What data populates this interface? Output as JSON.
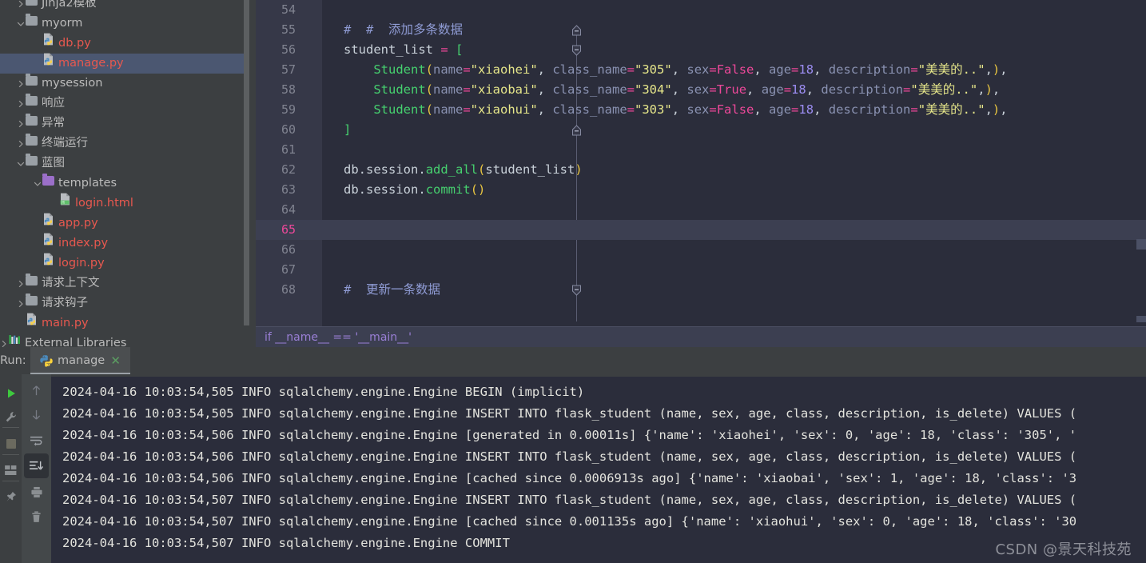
{
  "project_tree": {
    "items": [
      {
        "indent": 1,
        "arrow": "chevron-right",
        "icon": "folder",
        "label": "Jinja2模板",
        "kind": "plain",
        "selected": false,
        "clipped_top": true
      },
      {
        "indent": 1,
        "arrow": "chevron-down",
        "icon": "folder",
        "label": "myorm",
        "kind": "plain",
        "selected": false
      },
      {
        "indent": 2,
        "arrow": "none",
        "icon": "python-file",
        "label": "db.py",
        "kind": "py",
        "selected": false
      },
      {
        "indent": 2,
        "arrow": "none",
        "icon": "python-file",
        "label": "manage.py",
        "kind": "py",
        "selected": true
      },
      {
        "indent": 1,
        "arrow": "chevron-right",
        "icon": "folder",
        "label": "mysession",
        "kind": "plain",
        "selected": false
      },
      {
        "indent": 1,
        "arrow": "chevron-right",
        "icon": "folder",
        "label": "响应",
        "kind": "plain",
        "selected": false
      },
      {
        "indent": 1,
        "arrow": "chevron-right",
        "icon": "folder",
        "label": "异常",
        "kind": "plain",
        "selected": false
      },
      {
        "indent": 1,
        "arrow": "chevron-right",
        "icon": "folder",
        "label": "终端运行",
        "kind": "plain",
        "selected": false
      },
      {
        "indent": 1,
        "arrow": "chevron-down",
        "icon": "folder",
        "label": "蓝图",
        "kind": "plain",
        "selected": false
      },
      {
        "indent": 2,
        "arrow": "chevron-down",
        "icon": "folder-purple",
        "label": "templates",
        "kind": "plain",
        "selected": false
      },
      {
        "indent": 3,
        "arrow": "none",
        "icon": "html-file",
        "label": "login.html",
        "kind": "html",
        "selected": false
      },
      {
        "indent": 2,
        "arrow": "none",
        "icon": "python-file",
        "label": "app.py",
        "kind": "py",
        "selected": false
      },
      {
        "indent": 2,
        "arrow": "none",
        "icon": "python-file",
        "label": "index.py",
        "kind": "py",
        "selected": false
      },
      {
        "indent": 2,
        "arrow": "none",
        "icon": "python-file",
        "label": "login.py",
        "kind": "py",
        "selected": false
      },
      {
        "indent": 1,
        "arrow": "chevron-right",
        "icon": "folder",
        "label": "请求上下文",
        "kind": "plain",
        "selected": false
      },
      {
        "indent": 1,
        "arrow": "chevron-right",
        "icon": "folder",
        "label": "请求钩子",
        "kind": "plain",
        "selected": false
      },
      {
        "indent": 1,
        "arrow": "none",
        "icon": "python-file",
        "label": "main.py",
        "kind": "py",
        "selected": false
      },
      {
        "indent": 0,
        "arrow": "chevron-right",
        "icon": "libraries",
        "label": "External Libraries",
        "kind": "plain",
        "selected": false
      }
    ]
  },
  "editor": {
    "current_line": 65,
    "breadcrumb": "if __name__ == '__main__'",
    "lines": [
      {
        "num": 54,
        "fold": "none",
        "tokens": []
      },
      {
        "num": 55,
        "fold": "end",
        "tokens": [
          {
            "t": "#  #  添加多条数据",
            "c": "t-com"
          }
        ]
      },
      {
        "num": 56,
        "fold": "start",
        "tokens": [
          {
            "t": "student_list ",
            "c": "t-var"
          },
          {
            "t": "= ",
            "c": "t-op"
          },
          {
            "t": "[",
            "c": "t-brk"
          }
        ]
      },
      {
        "num": 57,
        "fold": "none",
        "tokens": [
          {
            "t": "    ",
            "c": "t-punc"
          },
          {
            "t": "Student",
            "c": "t-cls"
          },
          {
            "t": "(",
            "c": "t-paren"
          },
          {
            "t": "name",
            "c": "t-kwarg"
          },
          {
            "t": "=",
            "c": "t-op"
          },
          {
            "t": "\"xiaohei\"",
            "c": "t-str"
          },
          {
            "t": ", ",
            "c": "t-punc"
          },
          {
            "t": "class_name",
            "c": "t-kwarg"
          },
          {
            "t": "=",
            "c": "t-op"
          },
          {
            "t": "\"305\"",
            "c": "t-str"
          },
          {
            "t": ", ",
            "c": "t-punc"
          },
          {
            "t": "sex",
            "c": "t-kwarg"
          },
          {
            "t": "=",
            "c": "t-op"
          },
          {
            "t": "False",
            "c": "t-bool"
          },
          {
            "t": ", ",
            "c": "t-punc"
          },
          {
            "t": "age",
            "c": "t-kwarg"
          },
          {
            "t": "=",
            "c": "t-op"
          },
          {
            "t": "18",
            "c": "t-num"
          },
          {
            "t": ", ",
            "c": "t-punc"
          },
          {
            "t": "description",
            "c": "t-kwarg"
          },
          {
            "t": "=",
            "c": "t-op"
          },
          {
            "t": "\"美美的..\"",
            "c": "t-str"
          },
          {
            "t": ",",
            "c": "t-punc"
          },
          {
            "t": ")",
            "c": "t-paren"
          },
          {
            "t": ",",
            "c": "t-punc"
          }
        ]
      },
      {
        "num": 58,
        "fold": "none",
        "tokens": [
          {
            "t": "    ",
            "c": "t-punc"
          },
          {
            "t": "Student",
            "c": "t-cls"
          },
          {
            "t": "(",
            "c": "t-paren"
          },
          {
            "t": "name",
            "c": "t-kwarg"
          },
          {
            "t": "=",
            "c": "t-op"
          },
          {
            "t": "\"xiaobai\"",
            "c": "t-str"
          },
          {
            "t": ", ",
            "c": "t-punc"
          },
          {
            "t": "class_name",
            "c": "t-kwarg"
          },
          {
            "t": "=",
            "c": "t-op"
          },
          {
            "t": "\"304\"",
            "c": "t-str"
          },
          {
            "t": ", ",
            "c": "t-punc"
          },
          {
            "t": "sex",
            "c": "t-kwarg"
          },
          {
            "t": "=",
            "c": "t-op"
          },
          {
            "t": "True",
            "c": "t-bool"
          },
          {
            "t": ", ",
            "c": "t-punc"
          },
          {
            "t": "age",
            "c": "t-kwarg"
          },
          {
            "t": "=",
            "c": "t-op"
          },
          {
            "t": "18",
            "c": "t-num"
          },
          {
            "t": ", ",
            "c": "t-punc"
          },
          {
            "t": "description",
            "c": "t-kwarg"
          },
          {
            "t": "=",
            "c": "t-op"
          },
          {
            "t": "\"美美的..\"",
            "c": "t-str"
          },
          {
            "t": ",",
            "c": "t-punc"
          },
          {
            "t": ")",
            "c": "t-paren"
          },
          {
            "t": ",",
            "c": "t-punc"
          }
        ]
      },
      {
        "num": 59,
        "fold": "none",
        "tokens": [
          {
            "t": "    ",
            "c": "t-punc"
          },
          {
            "t": "Student",
            "c": "t-cls"
          },
          {
            "t": "(",
            "c": "t-paren"
          },
          {
            "t": "name",
            "c": "t-kwarg"
          },
          {
            "t": "=",
            "c": "t-op"
          },
          {
            "t": "\"xiaohui\"",
            "c": "t-str"
          },
          {
            "t": ", ",
            "c": "t-punc"
          },
          {
            "t": "class_name",
            "c": "t-kwarg"
          },
          {
            "t": "=",
            "c": "t-op"
          },
          {
            "t": "\"303\"",
            "c": "t-str"
          },
          {
            "t": ", ",
            "c": "t-punc"
          },
          {
            "t": "sex",
            "c": "t-kwarg"
          },
          {
            "t": "=",
            "c": "t-op"
          },
          {
            "t": "False",
            "c": "t-bool"
          },
          {
            "t": ", ",
            "c": "t-punc"
          },
          {
            "t": "age",
            "c": "t-kwarg"
          },
          {
            "t": "=",
            "c": "t-op"
          },
          {
            "t": "18",
            "c": "t-num"
          },
          {
            "t": ", ",
            "c": "t-punc"
          },
          {
            "t": "description",
            "c": "t-kwarg"
          },
          {
            "t": "=",
            "c": "t-op"
          },
          {
            "t": "\"美美的..\"",
            "c": "t-str"
          },
          {
            "t": ",",
            "c": "t-punc"
          },
          {
            "t": ")",
            "c": "t-paren"
          },
          {
            "t": ",",
            "c": "t-punc"
          }
        ]
      },
      {
        "num": 60,
        "fold": "end",
        "tokens": [
          {
            "t": "]",
            "c": "t-brk"
          }
        ]
      },
      {
        "num": 61,
        "fold": "none",
        "tokens": []
      },
      {
        "num": 62,
        "fold": "none",
        "tokens": [
          {
            "t": "db",
            "c": "t-var"
          },
          {
            "t": ".",
            "c": "t-dot"
          },
          {
            "t": "session",
            "c": "t-var"
          },
          {
            "t": ".",
            "c": "t-dot"
          },
          {
            "t": "add_all",
            "c": "t-meth"
          },
          {
            "t": "(",
            "c": "t-paren"
          },
          {
            "t": "student_list",
            "c": "t-var"
          },
          {
            "t": ")",
            "c": "t-paren"
          }
        ]
      },
      {
        "num": 63,
        "fold": "none",
        "tokens": [
          {
            "t": "db",
            "c": "t-var"
          },
          {
            "t": ".",
            "c": "t-dot"
          },
          {
            "t": "session",
            "c": "t-var"
          },
          {
            "t": ".",
            "c": "t-dot"
          },
          {
            "t": "commit",
            "c": "t-meth"
          },
          {
            "t": "(",
            "c": "t-paren"
          },
          {
            "t": ")",
            "c": "t-paren"
          }
        ]
      },
      {
        "num": 64,
        "fold": "none",
        "tokens": []
      },
      {
        "num": 65,
        "fold": "none",
        "tokens": []
      },
      {
        "num": 66,
        "fold": "none",
        "tokens": []
      },
      {
        "num": 67,
        "fold": "none",
        "tokens": []
      },
      {
        "num": 68,
        "fold": "start",
        "tokens": [
          {
            "t": "#  更新一条数据",
            "c": "t-com"
          }
        ]
      }
    ]
  },
  "run_panel": {
    "label": "Run:",
    "tab_name": "manage",
    "tab_close": "✕",
    "side_buttons_left": [
      {
        "name": "run-button",
        "icon": "play-icon"
      },
      {
        "name": "settings-button",
        "icon": "wrench-icon"
      },
      {
        "name": "stop-button",
        "icon": "stop-icon"
      },
      {
        "name": "layout-button",
        "icon": "layout-icon"
      },
      {
        "name": "pin-button",
        "icon": "pin-icon"
      }
    ],
    "side_buttons_right": [
      {
        "name": "scroll-up-button",
        "icon": "arrow-up-icon"
      },
      {
        "name": "scroll-down-button",
        "icon": "arrow-down-icon"
      },
      {
        "name": "soft-wrap-button",
        "icon": "wrap-icon"
      },
      {
        "name": "scroll-to-end-button",
        "icon": "scroll-end-icon"
      },
      {
        "name": "print-button",
        "icon": "printer-icon"
      },
      {
        "name": "clear-all-button",
        "icon": "trash-icon"
      }
    ],
    "console_lines": [
      "2024-04-16 10:03:54,505 INFO sqlalchemy.engine.Engine BEGIN (implicit)",
      "2024-04-16 10:03:54,505 INFO sqlalchemy.engine.Engine INSERT INTO flask_student (name, sex, age, class, description, is_delete) VALUES (",
      "2024-04-16 10:03:54,506 INFO sqlalchemy.engine.Engine [generated in 0.00011s] {'name': 'xiaohei', 'sex': 0, 'age': 18, 'class': '305', '",
      "2024-04-16 10:03:54,506 INFO sqlalchemy.engine.Engine INSERT INTO flask_student (name, sex, age, class, description, is_delete) VALUES (",
      "2024-04-16 10:03:54,506 INFO sqlalchemy.engine.Engine [cached since 0.0006913s ago] {'name': 'xiaobai', 'sex': 1, 'age': 18, 'class': '3",
      "2024-04-16 10:03:54,507 INFO sqlalchemy.engine.Engine INSERT INTO flask_student (name, sex, age, class, description, is_delete) VALUES (",
      "2024-04-16 10:03:54,507 INFO sqlalchemy.engine.Engine [cached since 0.001135s ago] {'name': 'xiaohui', 'sex': 0, 'age': 18, 'class': '30",
      "2024-04-16 10:03:54,507 INFO sqlalchemy.engine.Engine COMMIT"
    ]
  },
  "watermark": "CSDN @景天科技苑",
  "colors": {
    "tree_bg": "#3c3f41",
    "editor_bg": "#2b2d3b",
    "gutter_bg": "#363848",
    "selection": "#4b5771",
    "current_line": "#3c3f51",
    "py_label": "#e8584f",
    "string": "#e6e68a",
    "keyword_bool": "#ec4899",
    "comment": "#8f9bd4",
    "function": "#46d16f"
  }
}
